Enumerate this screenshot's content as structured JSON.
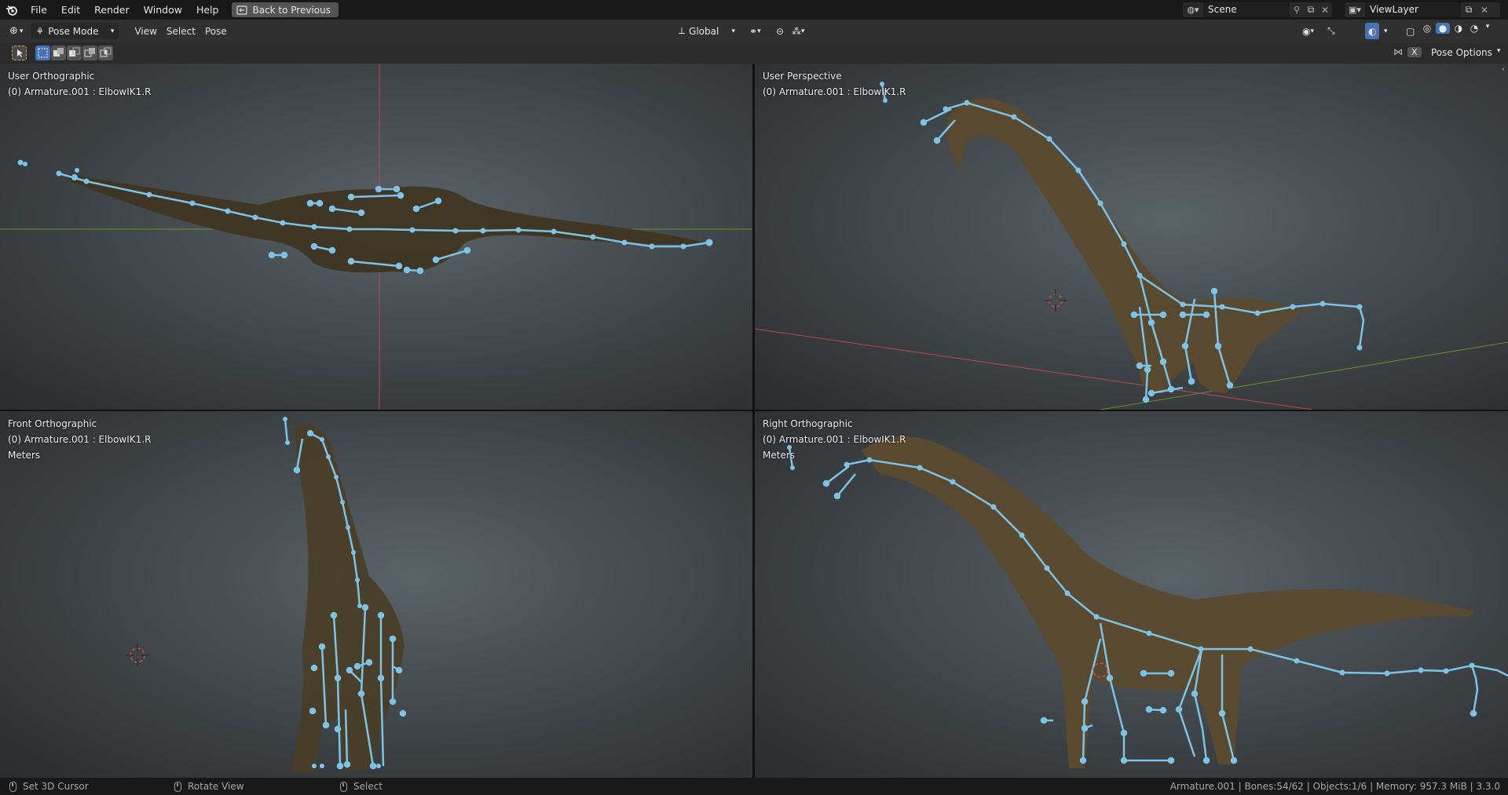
{
  "menubar": {
    "items": [
      "File",
      "Edit",
      "Render",
      "Window",
      "Help"
    ],
    "back_button": "Back to Previous",
    "scene": "Scene",
    "view_layer": "ViewLayer"
  },
  "header": {
    "mode": "Pose Mode",
    "menus": [
      "View",
      "Select",
      "Pose"
    ],
    "orientation": "Global",
    "pose_options": "Pose Options",
    "x_label": "X"
  },
  "viewports": {
    "top_left": {
      "view": "User Orthographic",
      "object": "(0) Armature.001 : ElbowIK1.R",
      "units": ""
    },
    "top_right": {
      "view": "User Perspective",
      "object": "(0) Armature.001 : ElbowIK1.R",
      "units": ""
    },
    "bottom_left": {
      "view": "Front Orthographic",
      "object": "(0) Armature.001 : ElbowIK1.R",
      "units": "Meters"
    },
    "bottom_right": {
      "view": "Right Orthographic",
      "object": "(0) Armature.001 : ElbowIK1.R",
      "units": "Meters"
    }
  },
  "statusbar": {
    "left_click": "Set 3D Cursor",
    "middle_click": "Rotate View",
    "right_click": "Select",
    "stats": "Armature.001 | Bones:54/62 | Objects:1/6 | Memory: 957.3 MiB | 3.3.0"
  },
  "colors": {
    "bone": "#7ec3e6",
    "bone_selected": "#6fe0e0",
    "x_axis": "#c4454f",
    "y_axis": "#6e8f2e",
    "dino_body": "#5b4a30"
  }
}
